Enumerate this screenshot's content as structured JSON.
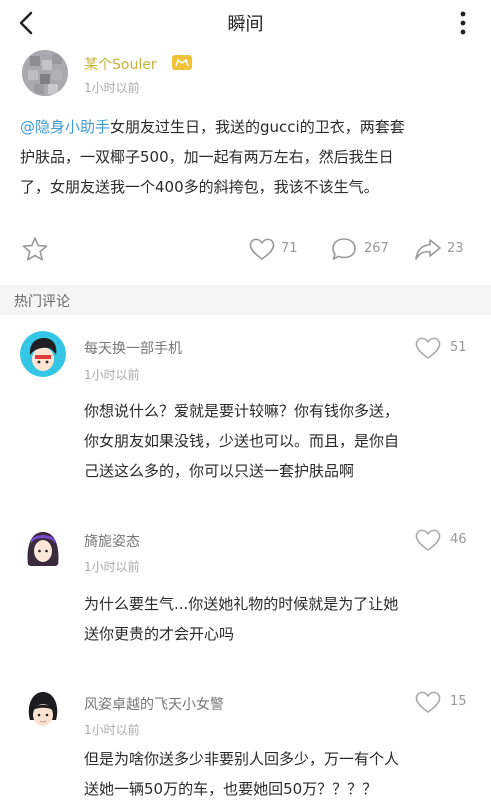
{
  "header": {
    "title": "瞬间",
    "back_icon": "chevron-left-icon",
    "more_icon": "vertical-dots-icon"
  },
  "post": {
    "username": "某个Souler",
    "time": "1小时以前",
    "mention": "@隐身小助手",
    "text_line1": "女朋友过生日，我送的gucci的卫衣，两套套",
    "text_line2": "护肤品，一双椰子500，加一起有两万左右，然后我生日",
    "text_line3": "了，女朋友送我一个400多的斜挎包，我该不该生气。",
    "likes": "71",
    "comments": "267",
    "shares": "23"
  },
  "section": {
    "hot_comments": "热门评论"
  },
  "comments": [
    {
      "name": "每天换一部手机",
      "time": "1小时以前",
      "likes": "51",
      "line1": "你想说什么？爱就是要计较嘛？你有钱你多送，",
      "line2": "你女朋友如果没钱，少送也可以。而且，是你自",
      "line3": "己送这么多的，你可以只送一套护肤品啊"
    },
    {
      "name": "旖旎姿态",
      "time": "1小时以前",
      "likes": "46",
      "line1": "为什么要生气...你送她礼物的时候就是为了让她",
      "line2": "送你更贵的才会开心吗"
    },
    {
      "name": "风姿卓越的飞天小女警",
      "time": "1小时以前",
      "likes": "15",
      "line1": "但是为啥你送多少非要别人回多少，万一有个人",
      "line2": "送她一辆50万的车，也要她回50万？？？？"
    }
  ],
  "colors": {
    "mention": "#3e9bd6",
    "username": "#c9b336",
    "badge": "#f0c23a"
  }
}
